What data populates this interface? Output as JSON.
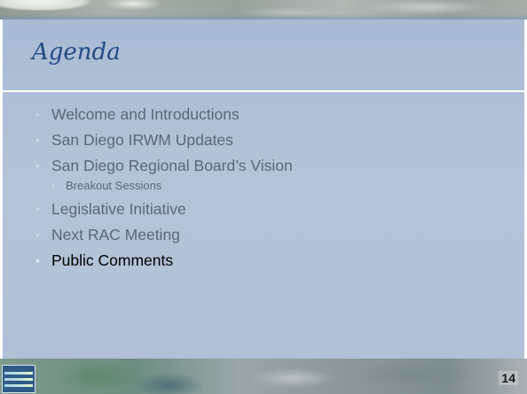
{
  "slide": {
    "title": "Agenda",
    "items": [
      {
        "label": "Welcome and Introductions",
        "level": 1,
        "active": false
      },
      {
        "label": "San Diego IRWM Updates",
        "level": 1,
        "active": false
      },
      {
        "label": "San Diego Regional Board’s Vision",
        "level": 1,
        "active": false
      },
      {
        "label": "Breakout Sessions",
        "level": 2,
        "active": false
      },
      {
        "label": "Legislative Initiative",
        "level": 1,
        "active": false
      },
      {
        "label": "Next RAC Meeting",
        "level": 1,
        "active": false
      },
      {
        "label": "Public Comments",
        "level": 1,
        "active": true
      }
    ],
    "page_number": "14"
  },
  "icons": {
    "bullet": "•",
    "sub_bullet": "▪"
  },
  "colors": {
    "title": "#234a87",
    "panel": "#b0c0d6",
    "inactive_text": "#5b6776",
    "active_text": "#000000"
  }
}
